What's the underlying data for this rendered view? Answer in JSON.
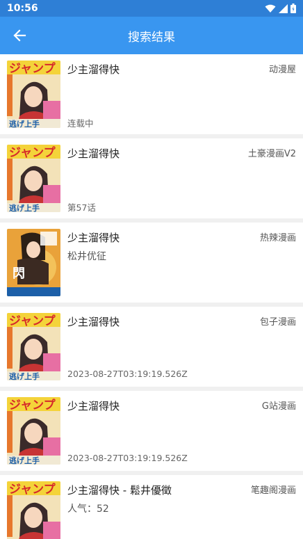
{
  "status": {
    "time": "10:56",
    "icons": [
      "wifi-icon",
      "signal-icon",
      "battery-icon"
    ]
  },
  "appbar": {
    "title": "搜索结果",
    "back_icon": "arrow-left-icon"
  },
  "colors": {
    "statusbar": "#2e7fd6",
    "appbar": "#3996f0",
    "text": "#222222"
  },
  "results": [
    {
      "name": "少主溜得快",
      "source": "动漫屋",
      "sub": "",
      "bottom": "连载中",
      "cover": "cover-a"
    },
    {
      "name": "少主溜得快",
      "source": "土豪漫画V2",
      "sub": "",
      "bottom": "第57话",
      "cover": "cover-a"
    },
    {
      "name": "少主溜得快",
      "source": "热辣漫画",
      "sub": "松井优征",
      "bottom": "",
      "cover": "cover-b"
    },
    {
      "name": "少主溜得快",
      "source": "包子漫画",
      "sub": "",
      "bottom": "2023-08-27T03:19:19.526Z",
      "cover": "cover-a"
    },
    {
      "name": "少主溜得快",
      "source": "G站漫画",
      "sub": "",
      "bottom": "2023-08-27T03:19:19.526Z",
      "cover": "cover-a"
    },
    {
      "name": "少主溜得快 - 鬆井優徵",
      "source": "笔趣阁漫画",
      "sub": "人气：52",
      "bottom": "",
      "cover": "cover-a"
    }
  ]
}
